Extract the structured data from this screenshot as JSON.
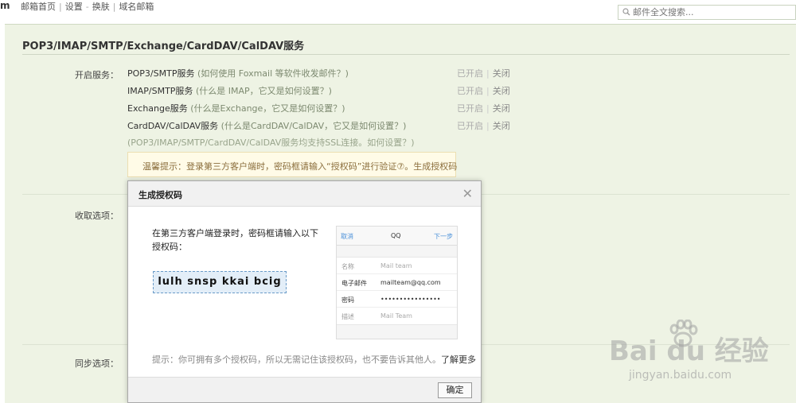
{
  "topbar": {
    "logo_fragment": "m",
    "nav": [
      "邮箱首页",
      "设置",
      "换肤",
      "域名邮箱"
    ],
    "search_placeholder": "邮件全文搜索..."
  },
  "section": {
    "title": "POP3/IMAP/SMTP/Exchange/CardDAV/CalDAV服务",
    "open_label": "开启服务：",
    "receive_label": "收取选项：",
    "sync_label": "同步选项：",
    "services": [
      {
        "name": "POP3/SMTP服务",
        "hint": "(如何使用 Foxmail 等软件收发邮件？)",
        "status": "已开启",
        "action": "关闭"
      },
      {
        "name": "IMAP/SMTP服务",
        "hint": "(什么是 IMAP，它又是如何设置？)",
        "status": "已开启",
        "action": "关闭"
      },
      {
        "name": "Exchange服务",
        "hint": "(什么是Exchange，它又是如何设置？)",
        "status": "已开启",
        "action": "关闭"
      },
      {
        "name": "CardDAV/CalDAV服务",
        "hint": "(什么是CardDAV/CalDAV，它又是如何设置？)",
        "status": "已开启",
        "action": "关闭"
      }
    ],
    "ssl_note": "(POP3/IMAP/SMTP/CardDAV/CalDAV服务均支持SSL连接。如何设置？)",
    "tip": "温馨提示：登录第三方客户端时，密码框请输入“授权码”进行验证⑦。生成授权码"
  },
  "dialog": {
    "title": "生成授权码",
    "instruction": "在第三方客户端登录时，密码框请输入以下授权码：",
    "auth_code": "lulh snsp kkai bcig",
    "phone": {
      "cancel": "取消",
      "title": "QQ",
      "next": "下一步",
      "rows": [
        {
          "key": "名称",
          "value": "Mail team",
          "muted": true
        },
        {
          "key": "电子邮件",
          "value": "mailteam@qq.com",
          "muted": false
        },
        {
          "key": "密码",
          "value": "••••••••••••••••",
          "muted": false
        },
        {
          "key": "描述",
          "value": "Mail Team",
          "muted": true
        }
      ]
    },
    "tip": "提示：你可拥有多个授权码，所以无需记住该授权码，也不要告诉其他人。",
    "learn_more": "了解更多",
    "ok_label": "确定"
  },
  "watermark": {
    "brand": "Bai du 经验",
    "url": "jingyan.baidu.com"
  },
  "colors": {
    "panel_bg": "#eef3e4",
    "tip_bg": "#fffbe7",
    "code_bg": "#e3eef8",
    "link_blue": "#4a90d9"
  }
}
